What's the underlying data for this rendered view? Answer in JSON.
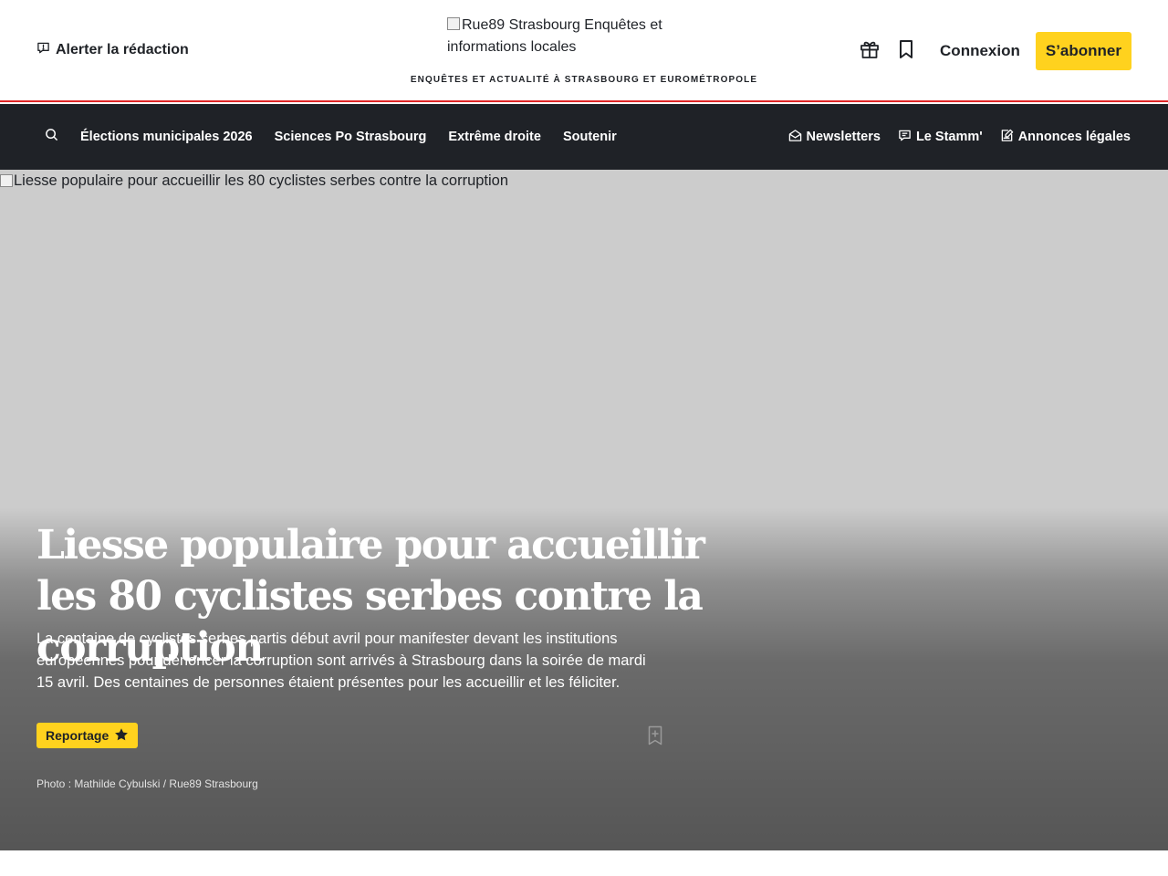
{
  "header": {
    "alert_label": "Alerter la rédaction",
    "logo_alt": "Rue89 Strasbourg Enquêtes et informations locales",
    "tagline": "ENQUÊTES ET ACTUALITÉ À STRASBOURG ET EUROMÉTROPOLE",
    "gift_icon": "gift-icon",
    "bookmark_icon": "bookmark-icon",
    "login_label": "Connexion",
    "subscribe_label": "S’abonner"
  },
  "nav": {
    "search_icon": "search-icon",
    "items": [
      {
        "label": "Élections municipales 2026"
      },
      {
        "label": "Sciences Po Strasbourg"
      },
      {
        "label": "Extrême droite"
      },
      {
        "label": "Soutenir"
      }
    ],
    "right_items": [
      {
        "label": "Newsletters",
        "icon": "envelope-icon"
      },
      {
        "label": "Le Stamm'",
        "icon": "chat-icon"
      },
      {
        "label": "Annonces légales",
        "icon": "edit-document-icon"
      }
    ]
  },
  "hero": {
    "image_alt": "Liesse populaire pour accueillir les 80 cyclistes serbes contre la corruption",
    "title": "Liesse populaire pour accueillir les 80 cyclistes serbes contre la corruption",
    "lead": "La centaine de cyclistes serbes partis début avril pour manifester devant les institutions européennes pour dénoncer la corruption sont arrivés à Strasbourg dans la soirée de mardi 15 avril. Des centaines de personnes étaient présentes pour les accueillir et les féliciter.",
    "badge_label": "Reportage",
    "badge_icon": "star-icon",
    "bookmark_icon": "bookmark-add-icon",
    "photo_credit": "Photo : Mathilde Cybulski / Rue89 Strasbourg"
  },
  "colors": {
    "accent_yellow": "#ffd21e",
    "nav_background": "#1f2227",
    "header_border": "#e02626",
    "hero_placeholder": "#cccccc"
  }
}
